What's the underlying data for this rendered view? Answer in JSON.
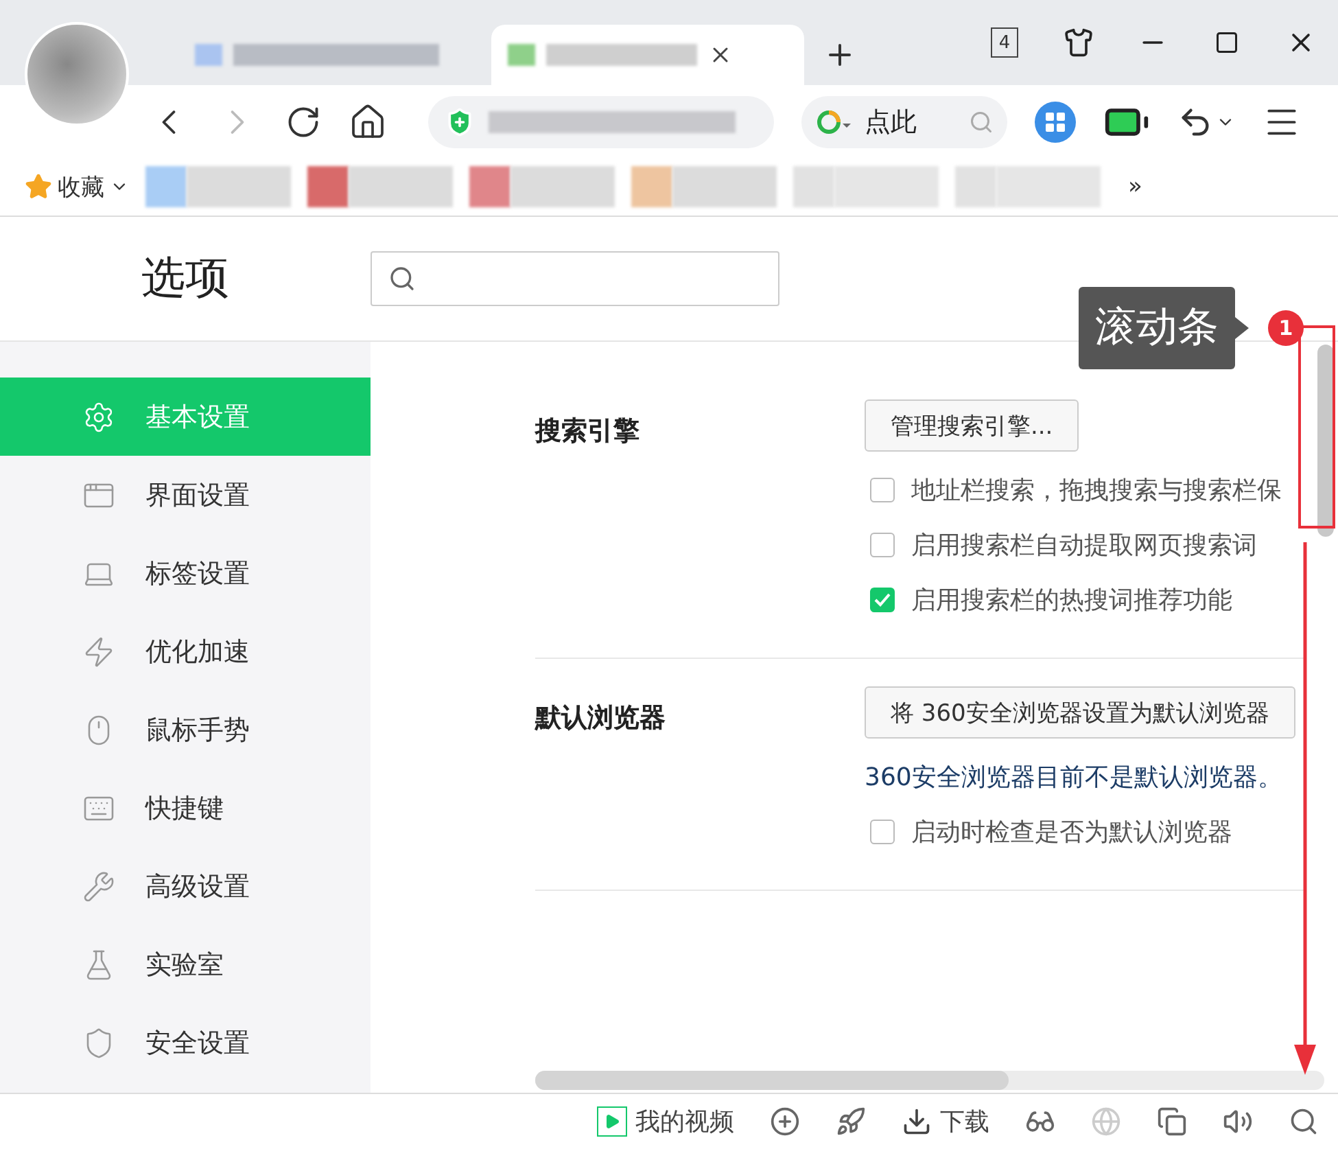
{
  "browser": {
    "tab_count": "4",
    "search_hint": "点此",
    "bookmarks_label": "收藏",
    "bookmarks_more": "»"
  },
  "options": {
    "title": "选项"
  },
  "sidebar": {
    "items": [
      {
        "label": "基本设置",
        "selected": true
      },
      {
        "label": "界面设置",
        "selected": false
      },
      {
        "label": "标签设置",
        "selected": false
      },
      {
        "label": "优化加速",
        "selected": false
      },
      {
        "label": "鼠标手势",
        "selected": false
      },
      {
        "label": "快捷键",
        "selected": false
      },
      {
        "label": "高级设置",
        "selected": false
      },
      {
        "label": "实验室",
        "selected": false
      },
      {
        "label": "安全设置",
        "selected": false
      }
    ]
  },
  "sections": [
    {
      "title": "搜索引擎",
      "button": "管理搜索引擎...",
      "items": [
        {
          "kind": "checkbox",
          "label": "地址栏搜索，拖拽搜索与搜索栏保",
          "checked": false
        },
        {
          "kind": "checkbox",
          "label": "启用搜索栏自动提取网页搜索词",
          "checked": false
        },
        {
          "kind": "checkbox",
          "label": "启用搜索栏的热搜词推荐功能",
          "checked": true
        }
      ]
    },
    {
      "title": "默认浏览器",
      "button": "将 360安全浏览器设置为默认浏览器",
      "items": [
        {
          "kind": "note",
          "label": "360安全浏览器目前不是默认浏览器。"
        },
        {
          "kind": "checkbox",
          "label": "启动时检查是否为默认浏览器",
          "checked": false
        }
      ]
    }
  ],
  "status_bar": {
    "items": [
      {
        "kind": "video",
        "label": "我的视频"
      },
      {
        "kind": "plus"
      },
      {
        "kind": "rocket"
      },
      {
        "kind": "download",
        "label": "下载"
      },
      {
        "kind": "glasses"
      },
      {
        "kind": "globe"
      },
      {
        "kind": "windows"
      },
      {
        "kind": "sound"
      },
      {
        "kind": "search"
      }
    ]
  },
  "annotation": {
    "label": "滚动条",
    "badge": "1"
  }
}
